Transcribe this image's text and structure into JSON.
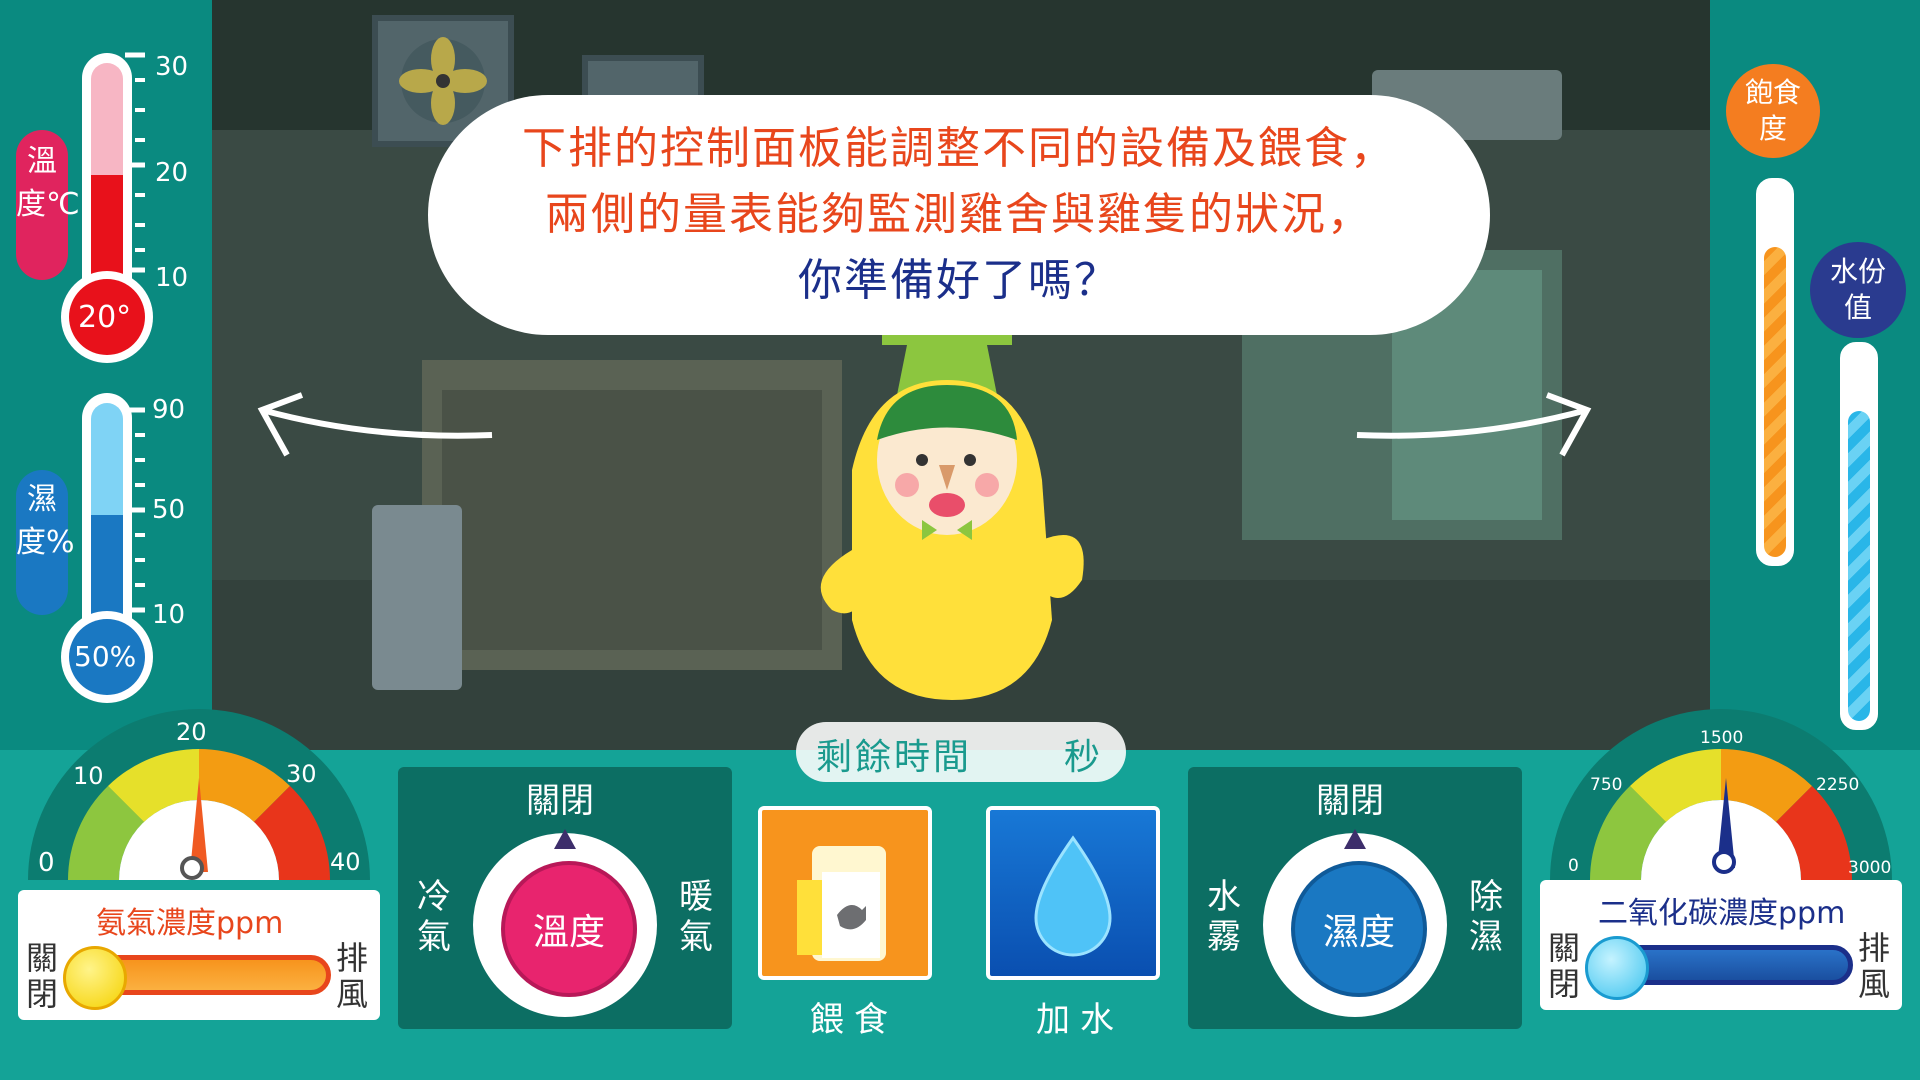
{
  "speech": {
    "line1": "下排的控制面板能調整不同的設備及餵食，",
    "line2": "兩側的量表能夠監測雞舍與雞隻的狀況，",
    "line3": "你準備好了嗎？"
  },
  "temperature_meter": {
    "label": "溫度℃",
    "ticks": [
      "30",
      "20",
      "10"
    ],
    "value": "20°",
    "level": 20,
    "range": [
      0,
      35
    ],
    "color": "#e8111b"
  },
  "humidity_meter": {
    "label": "濕度%",
    "ticks": [
      "90",
      "50",
      "10"
    ],
    "value": "50%",
    "level": 50,
    "color": "#1a78c2"
  },
  "satiety_meter": {
    "label": "飽食度",
    "color": "#f47d20"
  },
  "water_meter": {
    "label": "水份值",
    "color": "#2a3b8f"
  },
  "ammonia_gauge": {
    "ticks": [
      "0",
      "10",
      "20",
      "30",
      "40"
    ],
    "label": "氨氣濃度ppm",
    "slider_left": "關閉",
    "slider_right": "排風",
    "needle_value": 20
  },
  "co2_gauge": {
    "ticks": [
      "0",
      "750",
      "1500",
      "2250",
      "3000"
    ],
    "label": "二氧化碳濃度ppm",
    "slider_left": "關閉",
    "slider_right": "排風",
    "needle_value": 1500
  },
  "temp_control": {
    "state": "關閉",
    "knob": "溫度",
    "left": "冷氣",
    "right": "暖氣"
  },
  "humid_control": {
    "state": "關閉",
    "knob": "濕度",
    "left": "水霧",
    "right": "除濕"
  },
  "timer": {
    "prefix": "剩餘時間",
    "suffix": "秒"
  },
  "feed_button": {
    "label": "餵食"
  },
  "water_button": {
    "label": "加水"
  }
}
